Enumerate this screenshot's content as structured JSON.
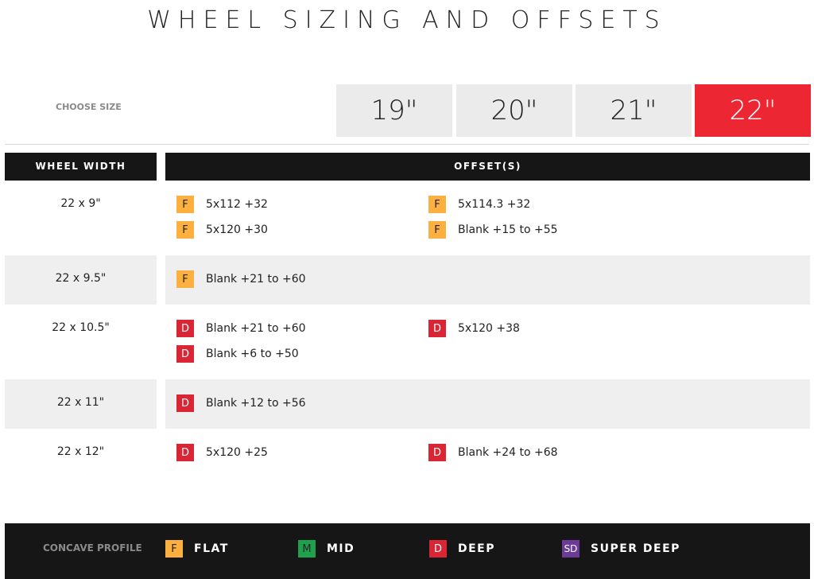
{
  "title": "WHEEL SIZING AND OFFSETS",
  "size_selector": {
    "label": "CHOOSE SIZE",
    "sizes": [
      "19\"",
      "20\"",
      "21\"",
      "22\""
    ],
    "active": "22\"",
    "active_color": "#ed2633"
  },
  "table": {
    "headers": {
      "width": "WHEEL WIDTH",
      "offsets": "OFFSET(S)"
    },
    "rows": [
      {
        "width": "22 x 9\"",
        "offsets": [
          {
            "profile": "F",
            "value": "5x112 +32"
          },
          {
            "profile": "F",
            "value": "5x114.3 +32"
          },
          {
            "profile": "F",
            "value": "5x120 +30"
          },
          {
            "profile": "F",
            "value": "Blank +15 to +55"
          }
        ]
      },
      {
        "width": "22 x 9.5\"",
        "offsets": [
          {
            "profile": "F",
            "value": "Blank +21 to +60"
          }
        ]
      },
      {
        "width": "22 x 10.5\"",
        "offsets": [
          {
            "profile": "D",
            "value": "Blank +21 to +60"
          },
          {
            "profile": "D",
            "value": "5x120 +38"
          },
          {
            "profile": "D",
            "value": "Blank +6 to +50"
          }
        ]
      },
      {
        "width": "22 x 11\"",
        "offsets": [
          {
            "profile": "D",
            "value": "Blank +12 to +56"
          }
        ]
      },
      {
        "width": "22 x 12\"",
        "offsets": [
          {
            "profile": "D",
            "value": "5x120 +25"
          },
          {
            "profile": "D",
            "value": "Blank +24 to +68"
          }
        ]
      }
    ]
  },
  "legend": {
    "label": "CONCAVE PROFILE",
    "items": [
      {
        "code": "F",
        "name": "FLAT",
        "color": "#fbb040"
      },
      {
        "code": "M",
        "name": "MID",
        "color": "#1fa04c"
      },
      {
        "code": "D",
        "name": "DEEP",
        "color": "#da2535"
      },
      {
        "code": "SD",
        "name": "SUPER DEEP",
        "color": "#6b3b97"
      }
    ]
  }
}
